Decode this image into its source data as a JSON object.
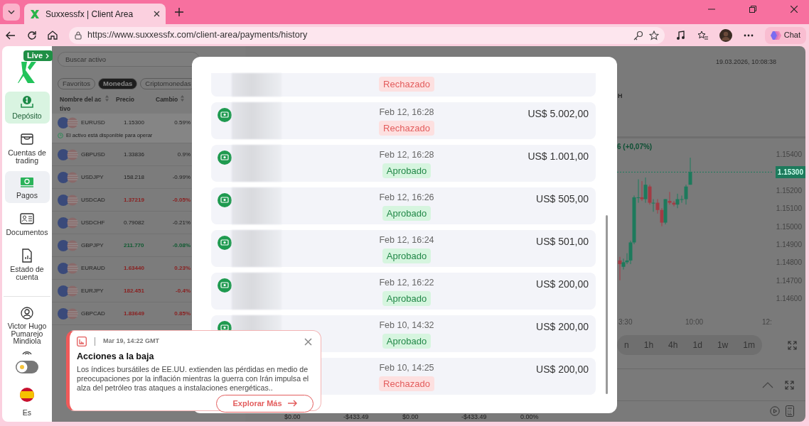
{
  "browser": {
    "tab_title": "Suxxessfx | Client Area",
    "url": "https://www.suxxessfx.com/client-area/payments/history",
    "chat_label": "Chat"
  },
  "sidebar": {
    "badge": "Live",
    "items": [
      {
        "label": "Depósito",
        "kind": "deposit",
        "selected": false
      },
      {
        "label": "Cuentas de trading",
        "kind": "accounts",
        "selected": false
      },
      {
        "label": "Pagos",
        "kind": "payments",
        "selected": true
      },
      {
        "label": "Documentos",
        "kind": "documents",
        "selected": false
      },
      {
        "label": "Estado de cuenta",
        "kind": "statement",
        "selected": false
      }
    ],
    "user_name": "Victor Hugo Pumarejo Mindiola",
    "theme_toggle": {
      "on": false
    },
    "language": "Es"
  },
  "market": {
    "search": {
      "placeholder": "Buscar activo"
    },
    "filters": [
      {
        "label": "Favoritos",
        "selected": false
      },
      {
        "label": "Monedas",
        "selected": true
      },
      {
        "label": "Criptomonedas",
        "selected": false
      }
    ],
    "columns": [
      "Nombre del activo",
      "Precio",
      "Cambio"
    ],
    "rows": [
      {
        "symbol": "EURUSD",
        "price": "1.15300",
        "change": "0.59%",
        "selected": true,
        "note": "El activo está disponible para operar"
      },
      {
        "symbol": "GBPUSD",
        "price": "1.33836",
        "change": "0.9%",
        "selected": false
      },
      {
        "symbol": "USDJPY",
        "price": "158.218",
        "change": "-0.99%",
        "selected": false
      },
      {
        "symbol": "USDCAD",
        "price": "1.37219",
        "change": "-0.05%",
        "color": "#8a2020",
        "selected": false
      },
      {
        "symbol": "USDCHF",
        "price": "0.79082",
        "change": "-0.21%",
        "selected": false
      },
      {
        "symbol": "GBPJPY",
        "price": "211.770",
        "change": "-0.08%",
        "color": "#0e5a30",
        "selected": false
      },
      {
        "symbol": "EURAUD",
        "price": "1.63440",
        "change": "0.23%",
        "color": "#8a2020",
        "selected": false
      },
      {
        "symbol": "EURJPY",
        "price": "182.451",
        "change": "-0.4%",
        "color": "#8a2020",
        "selected": false
      },
      {
        "symbol": "GBPCAD",
        "price": "1.83649",
        "change": "0.85%",
        "color": "#8a2020",
        "selected": false
      }
    ]
  },
  "summary": [
    "$0.00",
    "-$433.49",
    "$0.00",
    "-$433.49",
    "0.00%"
  ],
  "chart": {
    "datetime": "19.03.2026, 10:08:38",
    "symbol_fragment": "H",
    "change": "6 (+0,07%)",
    "price_ticks": [
      "1.15400",
      "1.15200",
      "1.15100",
      "1.15000",
      "1.14900",
      "1.14800",
      "1.14700",
      "1.14600"
    ],
    "current_price": "1.15300",
    "time_labels": [
      "3:30",
      "10:00",
      "12:"
    ],
    "timeframes": [
      "n",
      "1h",
      "4h",
      "1d",
      "1w",
      "1m"
    ]
  },
  "payments": [
    {
      "status": "Rechazado",
      "approved": false
    },
    {
      "date": "Feb 12, 16:28",
      "amount": "US$ 5.002,00",
      "status": "Rechazado",
      "approved": false
    },
    {
      "date": "Feb 12, 16:28",
      "amount": "US$ 1.001,00",
      "status": "Aprobado",
      "approved": true
    },
    {
      "date": "Feb 12, 16:26",
      "amount": "US$ 505,00",
      "status": "Aprobado",
      "approved": true
    },
    {
      "date": "Feb 12, 16:24",
      "amount": "US$ 501,00",
      "status": "Aprobado",
      "approved": true
    },
    {
      "date": "Feb 12, 16:22",
      "amount": "US$ 200,00",
      "status": "Aprobado",
      "approved": true
    },
    {
      "date": "Feb 10, 14:32",
      "amount": "US$ 200,00",
      "status": "Aprobado",
      "approved": true
    },
    {
      "date": "Feb 10, 14:25",
      "amount": "US$ 200,00",
      "status": "Rechazado",
      "approved": false
    }
  ],
  "notification": {
    "date": "Mar 19, 14:22 GMT",
    "title": "Acciones a la baja",
    "body": "Los índices bursátiles de EE.UU. extienden las pérdidas en medio de preocupaciones por la inflación mientras la guerra con Irán impulsa el alza del petróleo tras ataques a instalaciones energéticas..",
    "button": "Explorar Más"
  }
}
